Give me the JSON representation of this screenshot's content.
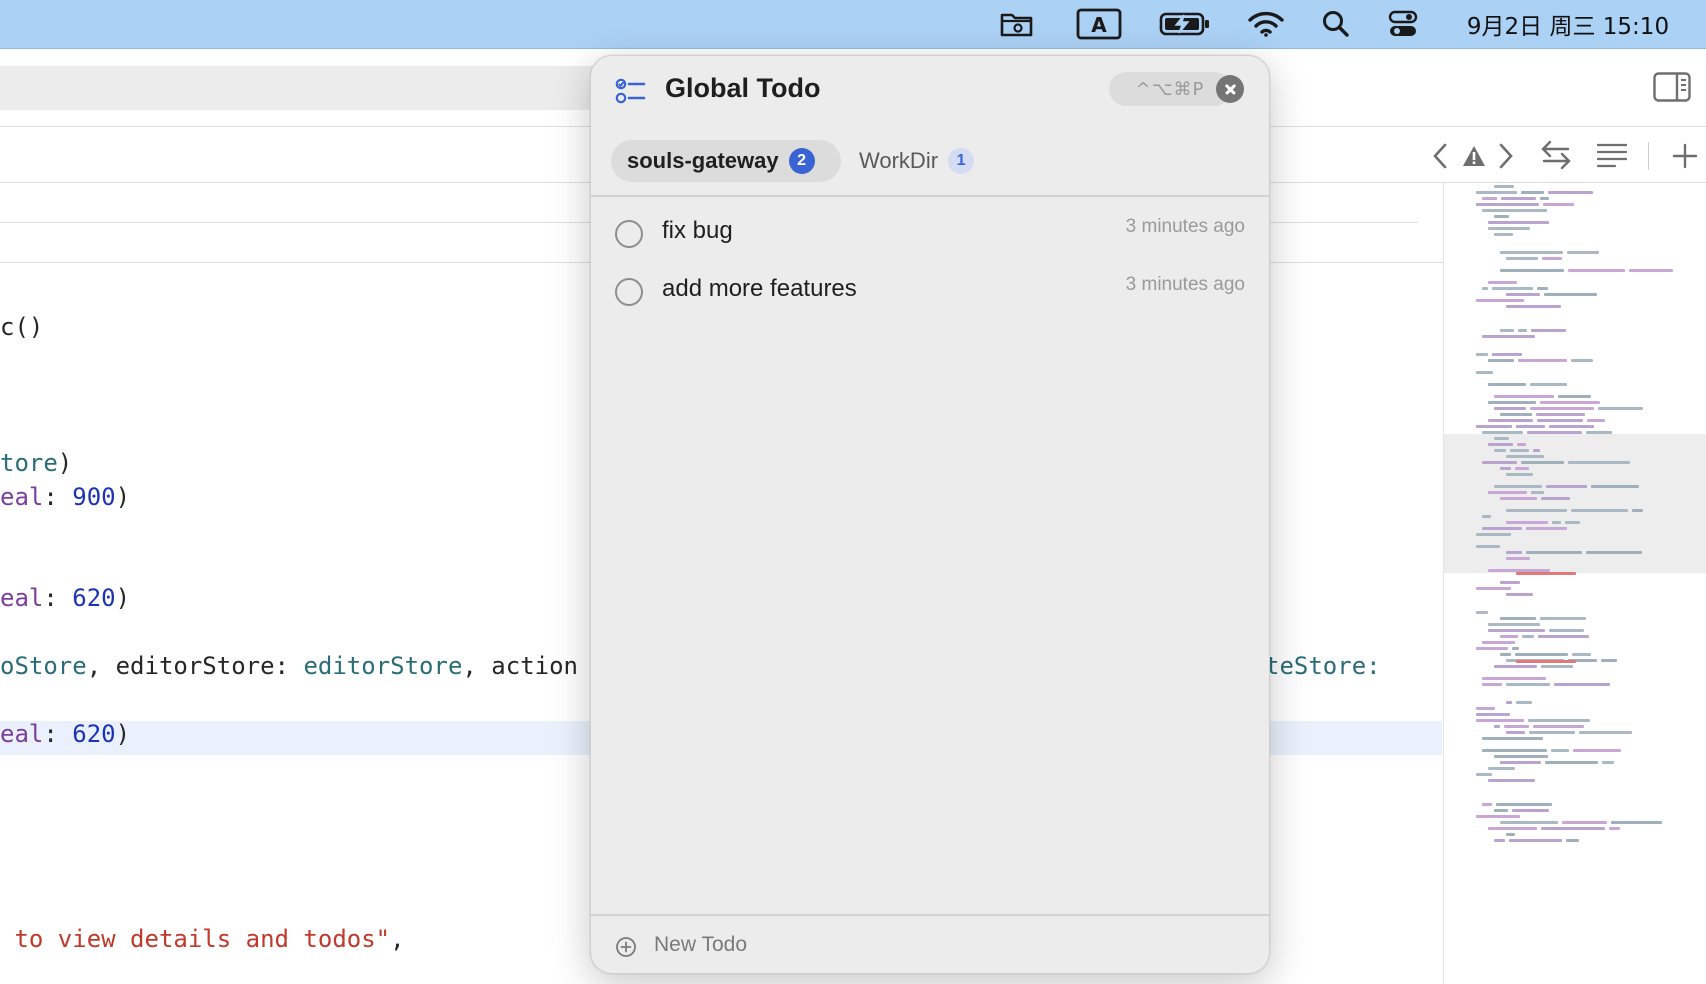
{
  "menubar": {
    "icons": [
      "folder-badge-icon",
      "input-source-icon",
      "battery-charging-icon",
      "wifi-icon",
      "spotlight-search-icon",
      "control-center-icon"
    ],
    "input_source_label": "A",
    "clock": "9月2日 周三  15:10"
  },
  "editor": {
    "code_lines": [
      {
        "parts": [
          {
            "t": "c()",
            "k": ""
          }
        ]
      },
      {
        "parts": [
          {
            "t": "tore",
            "k": "type"
          },
          {
            "t": ")",
            "k": ""
          }
        ]
      },
      {
        "parts": [
          {
            "t": "eal",
            "k": "kw"
          },
          {
            "t": ": ",
            "k": ""
          },
          {
            "t": "900",
            "k": "num"
          },
          {
            "t": ")",
            "k": ""
          }
        ]
      },
      {
        "parts": [
          {
            "t": "eal",
            "k": "kw"
          },
          {
            "t": ": ",
            "k": ""
          },
          {
            "t": "620",
            "k": "num"
          },
          {
            "t": ")",
            "k": ""
          }
        ]
      },
      {
        "parts": [
          {
            "t": "oStore",
            "k": "type"
          },
          {
            "t": ", editorStore: ",
            "k": ""
          },
          {
            "t": "editorStore",
            "k": "type"
          },
          {
            "t": ", action",
            "k": ""
          }
        ]
      },
      {
        "parts": [
          {
            "t": "eal",
            "k": "kw"
          },
          {
            "t": ": ",
            "k": ""
          },
          {
            "t": "620",
            "k": "num"
          },
          {
            "t": ")",
            "k": ""
          }
        ]
      },
      {
        "parts": [
          {
            "t": " to view details and todos\"",
            "k": "str"
          },
          {
            "t": ",",
            "k": ""
          }
        ]
      }
    ],
    "right_fragment": "teStore:",
    "toolbar_icons": [
      "chevron-left-icon",
      "warning-icon",
      "chevron-right-icon",
      "swap-arrows-icon",
      "text-align-icon",
      "add-icon"
    ],
    "inspector_icon": "sidebar-right-icon"
  },
  "panel": {
    "title": "Global Todo",
    "shortcut": "^⌥⌘P",
    "close_icon": "close-icon",
    "app_icon": "checklist-icon",
    "tabs": [
      {
        "label": "souls-gateway",
        "count": "2",
        "active": true
      },
      {
        "label": "WorkDir",
        "count": "1",
        "active": false
      }
    ],
    "todos": [
      {
        "text": "fix bug",
        "time": "3 minutes ago"
      },
      {
        "text": "add more features",
        "time": "3 minutes ago"
      }
    ],
    "new_todo_label": "New Todo",
    "new_todo_icon": "plus-circle-icon"
  },
  "colors": {
    "menubar": "#abd1f5",
    "accent": "#3a63d4",
    "panel_bg": "#ececec"
  }
}
